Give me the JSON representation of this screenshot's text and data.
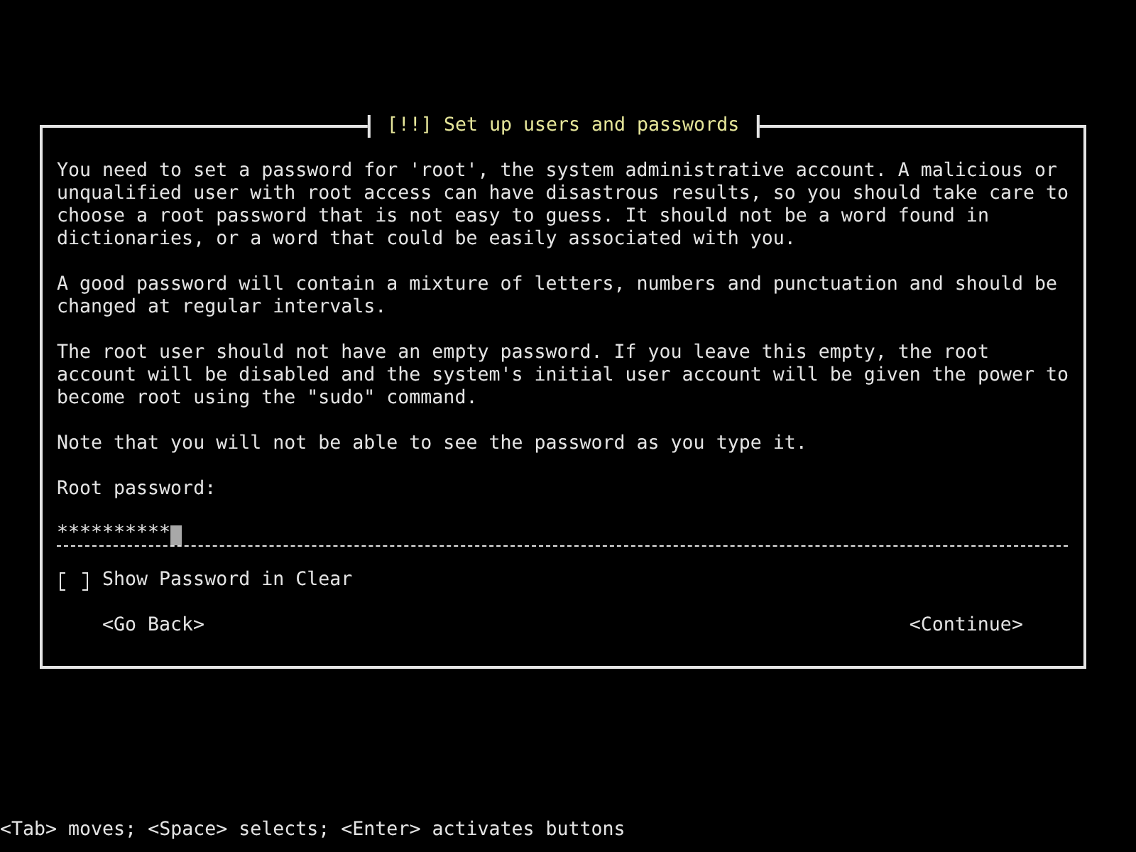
{
  "dialog": {
    "title": "[!!] Set up users and passwords",
    "paragraphs": [
      "You need to set a password for 'root', the system administrative account. A malicious or unqualified user with root access can have disastrous results, so you should take care to choose a root password that is not easy to guess. It should not be a word found in dictionaries, or a word that could be easily associated with you.",
      "A good password will contain a mixture of letters, numbers and punctuation and should be changed at regular intervals.",
      "The root user should not have an empty password. If you leave this empty, the root account will be disabled and the system's initial user account will be given the power to become root using the \"sudo\" command.",
      "Note that you will not be able to see the password as you type it."
    ],
    "field": {
      "label": "Root password:",
      "value": "**********"
    },
    "checkbox": {
      "label": "Show Password in Clear",
      "checked": false
    },
    "buttons": [
      {
        "label": "<Go Back>"
      },
      {
        "label": "<Continue>"
      }
    ]
  },
  "status_bar": "<Tab> moves; <Space> selects; <Enter> activates buttons"
}
